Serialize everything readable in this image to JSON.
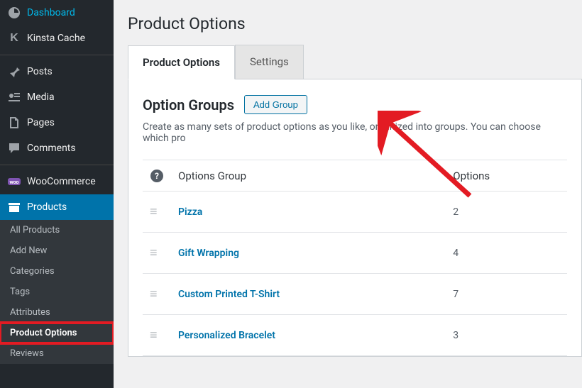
{
  "sidebar": {
    "items": [
      {
        "label": "Dashboard",
        "icon": "dashboard"
      },
      {
        "label": "Kinsta Cache",
        "icon": "kinsta"
      },
      {
        "label": "Posts",
        "icon": "pin"
      },
      {
        "label": "Media",
        "icon": "media"
      },
      {
        "label": "Pages",
        "icon": "page"
      },
      {
        "label": "Comments",
        "icon": "comment"
      },
      {
        "label": "WooCommerce",
        "icon": "woo"
      },
      {
        "label": "Products",
        "icon": "products",
        "active": true
      }
    ],
    "submenu": [
      {
        "label": "All Products"
      },
      {
        "label": "Add New"
      },
      {
        "label": "Categories"
      },
      {
        "label": "Tags"
      },
      {
        "label": "Attributes"
      },
      {
        "label": "Product Options",
        "highlighted": true
      },
      {
        "label": "Reviews"
      }
    ]
  },
  "header": {
    "page_title": "Product Options"
  },
  "tabs": [
    {
      "label": "Product Options",
      "active": true
    },
    {
      "label": "Settings"
    }
  ],
  "section": {
    "title": "Option Groups",
    "add_button": "Add Group",
    "description": "Create as many sets of product options as you like, organized into groups. You can choose which pro"
  },
  "table": {
    "columns": {
      "group": "Options Group",
      "options": "Options"
    },
    "rows": [
      {
        "name": "Pizza",
        "options": "2"
      },
      {
        "name": "Gift Wrapping",
        "options": "4"
      },
      {
        "name": "Custom Printed T-Shirt",
        "options": "7"
      },
      {
        "name": "Personalized Bracelet",
        "options": "3"
      }
    ]
  }
}
